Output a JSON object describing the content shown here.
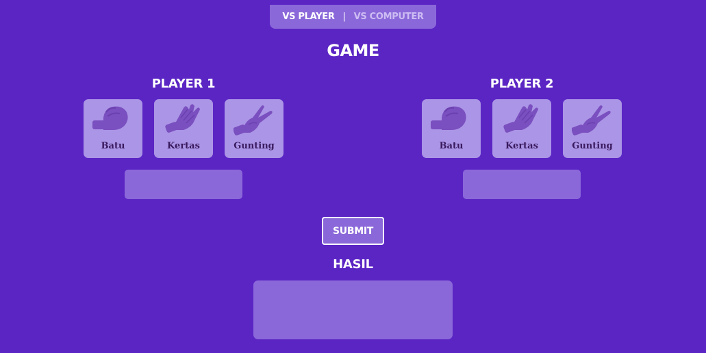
{
  "mode_tabs": {
    "vs_player": "VS PLAYER",
    "separator": "|",
    "vs_computer": "VS COMPUTER"
  },
  "title": "GAME",
  "players": [
    {
      "name": "PLAYER 1",
      "choices": [
        {
          "label": "Batu",
          "icon": "rock-hand-icon"
        },
        {
          "label": "Kertas",
          "icon": "paper-hand-icon"
        },
        {
          "label": "Gunting",
          "icon": "scissors-hand-icon"
        }
      ],
      "selection": ""
    },
    {
      "name": "PLAYER 2",
      "choices": [
        {
          "label": "Batu",
          "icon": "rock-hand-icon"
        },
        {
          "label": "Kertas",
          "icon": "paper-hand-icon"
        },
        {
          "label": "Gunting",
          "icon": "scissors-hand-icon"
        }
      ],
      "selection": ""
    }
  ],
  "submit_label": "SUBMIT",
  "hasil": {
    "title": "HASIL",
    "value": ""
  },
  "colors": {
    "background": "#5b25c4",
    "panel": "#8b68d9",
    "card": "#ab95e6",
    "hand": "#7a4fbf",
    "label": "#3a1a5e"
  }
}
